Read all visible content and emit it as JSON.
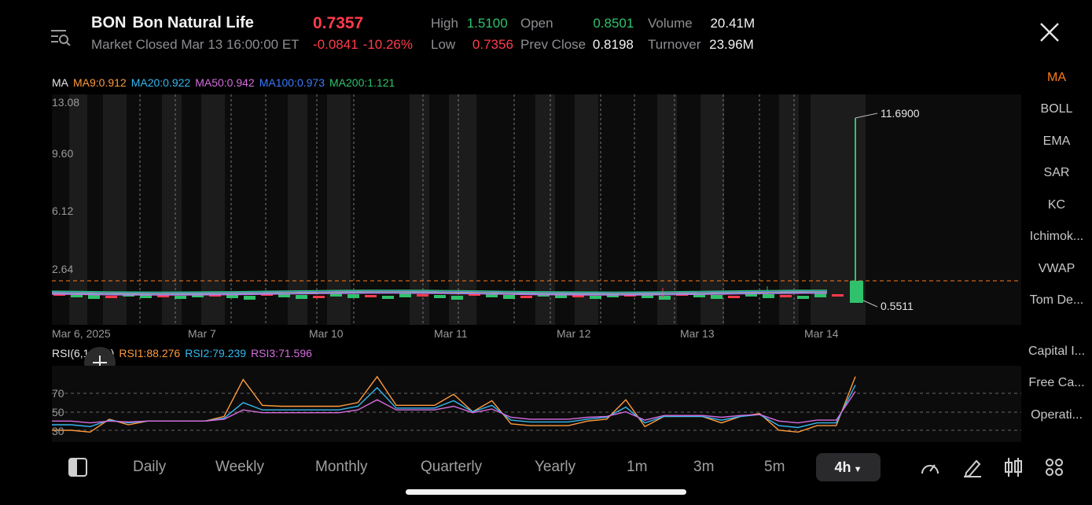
{
  "header": {
    "ticker": "BON",
    "company": "Bon Natural Life",
    "status": "Market Closed Mar 13 16:00:00 ET",
    "price": "0.7357",
    "change": "-0.0841",
    "change_pct": "-10.26%",
    "high_label": "High",
    "high": "1.5100",
    "low_label": "Low",
    "low": "0.7356",
    "open_label": "Open",
    "open": "0.8501",
    "prev_close_label": "Prev Close",
    "prev_close": "0.8198",
    "volume_label": "Volume",
    "volume": "20.41M",
    "turnover_label": "Turnover",
    "turnover": "23.96M"
  },
  "ma_legend": {
    "label": "MA",
    "ma9": "MA9:0.912",
    "ma20": "MA20:0.922",
    "ma50": "MA50:0.942",
    "ma100": "MA100:0.973",
    "ma200": "MA200:1.121"
  },
  "price_axis": [
    "13.08",
    "9.60",
    "6.12",
    "2.64"
  ],
  "price_markers": {
    "high": "11.6900",
    "low": "0.5511"
  },
  "date_axis": [
    "Mar 6, 2025",
    "Mar 7",
    "Mar 10",
    "Mar 11",
    "Mar 12",
    "Mar 13",
    "Mar 14"
  ],
  "rsi_legend": {
    "label": "RSI(6,12,24)",
    "rsi1": "RSI1:88.276",
    "rsi2": "RSI2:79.239",
    "rsi3": "RSI3:71.596"
  },
  "rsi_axis": [
    "70",
    "50",
    "30"
  ],
  "side_menu": [
    "MA",
    "BOLL",
    "EMA",
    "SAR",
    "KC",
    "Ichimok...",
    "VWAP",
    "Tom De...",
    "Capital I...",
    "Free Ca...",
    "Operati..."
  ],
  "tabs": [
    "Daily",
    "Weekly",
    "Monthly",
    "Quarterly",
    "Yearly",
    "1m",
    "3m",
    "5m"
  ],
  "active_tab": "4h",
  "colors": {
    "up": "#2fc26b",
    "down": "#ff3b4b",
    "ma9": "#ff9a3c",
    "ma20": "#35b8f0",
    "ma50": "#d66ce0",
    "ma100": "#3b7bff",
    "ma200": "#2fc26b",
    "accent": "#ff7a1a"
  },
  "chart_data": {
    "type": "candlestick",
    "y_ticks": [
      13.08,
      9.6,
      6.12,
      2.64
    ],
    "last_candle": {
      "high": 11.69,
      "low": 0.5511
    },
    "rsi_series": [
      {
        "name": "RSI1",
        "values": [
          30,
          30,
          28,
          42,
          36,
          40,
          40,
          40,
          40,
          45,
          85,
          57,
          56,
          56,
          56,
          56,
          60,
          88,
          57,
          57,
          57,
          69,
          50,
          62,
          37,
          35,
          35,
          35,
          40,
          42,
          63,
          34,
          45,
          45,
          45,
          38,
          45,
          48,
          30,
          28,
          35,
          35,
          88
        ]
      },
      {
        "name": "RSI2",
        "values": [
          36,
          36,
          34,
          41,
          38,
          40,
          40,
          40,
          40,
          43,
          60,
          52,
          52,
          52,
          52,
          52,
          56,
          76,
          54,
          54,
          54,
          62,
          50,
          57,
          41,
          39,
          39,
          39,
          42,
          44,
          55,
          38,
          45,
          45,
          45,
          41,
          45,
          47,
          35,
          33,
          38,
          38,
          79
        ]
      },
      {
        "name": "RSI3",
        "values": [
          40,
          40,
          38,
          40,
          39,
          40,
          40,
          40,
          40,
          42,
          52,
          49,
          49,
          49,
          49,
          49,
          52,
          63,
          52,
          52,
          52,
          56,
          49,
          53,
          44,
          42,
          42,
          42,
          44,
          45,
          50,
          41,
          46,
          46,
          46,
          44,
          46,
          47,
          40,
          38,
          41,
          41,
          72
        ]
      }
    ]
  }
}
